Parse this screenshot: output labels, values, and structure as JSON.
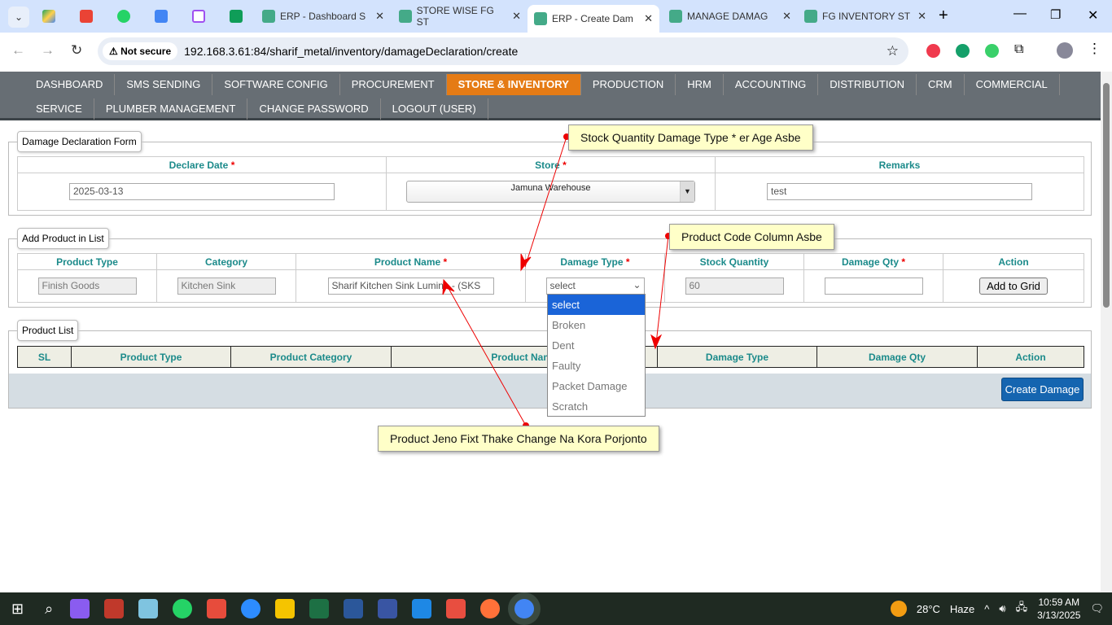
{
  "browser": {
    "tabs": [
      {
        "label": "ERP - Dashboard S"
      },
      {
        "label": "STORE WISE FG ST"
      },
      {
        "label": "ERP - Create Dam"
      },
      {
        "label": "MANAGE DAMAG"
      },
      {
        "label": "FG INVENTORY ST"
      }
    ],
    "not_secure": "Not secure",
    "url": "192.168.3.61:84/sharif_metal/inventory/damageDeclaration/create"
  },
  "nav": {
    "row1": [
      "DASHBOARD",
      "SMS SENDING",
      "SOFTWARE CONFIG",
      "PROCUREMENT",
      "STORE & INVENTORY",
      "PRODUCTION",
      "HRM",
      "ACCOUNTING",
      "DISTRIBUTION",
      "CRM",
      "COMMERCIAL"
    ],
    "row2": [
      "SERVICE",
      "PLUMBER MANAGEMENT",
      "CHANGE PASSWORD",
      "LOGOUT (USER)"
    ],
    "active": "STORE & INVENTORY"
  },
  "form": {
    "legend": "Damage Declaration Form",
    "declare_date_label": "Declare Date",
    "store_label": "Store",
    "remarks_label": "Remarks",
    "declare_date": "2025-03-13",
    "store": "Jamuna Warehouse",
    "remarks": "test",
    "req": "*"
  },
  "add": {
    "legend": "Add Product in List",
    "headers": [
      "Product Type",
      "Category",
      "Product Name",
      "Damage Type",
      "Stock Quantity",
      "Damage Qty",
      "Action"
    ],
    "product_type": "Finish Goods",
    "category": "Kitchen Sink",
    "product_name": "Sharif Kitchen Sink Lumina - (SKS",
    "damage_type": "select",
    "stock_qty": "60",
    "damage_qty": "",
    "add_button": "Add to Grid",
    "options": [
      "select",
      "Broken",
      "Dent",
      "Faulty",
      "Packet Damage",
      "Scratch"
    ]
  },
  "list": {
    "legend": "Product List",
    "headers": [
      "SL",
      "Product Type",
      "Product Category",
      "Product Name",
      "Damage Type",
      "Damage Qty",
      "Action"
    ],
    "create_button": "Create Damage"
  },
  "notes": [
    "Stock Quantity Damage Type * er Age Asbe",
    "Product Code Column Asbe",
    "Product Jeno Fixt Thake Change Na Kora Porjonto"
  ],
  "tray": {
    "temp": "28°C",
    "weather": "Haze",
    "time": "10:59 AM",
    "date": "3/13/2025"
  }
}
